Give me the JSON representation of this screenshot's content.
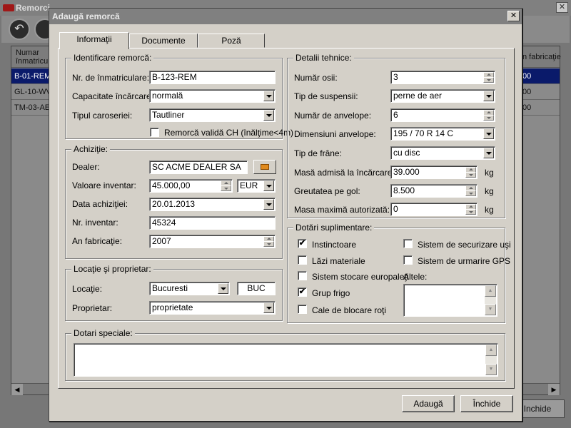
{
  "background": {
    "title": "Remorci",
    "grid_headers": [
      "Numar\nînmatricul",
      "n fabricaţie"
    ],
    "rows": [
      {
        "c1": "B-01-REM",
        "c2": "00",
        "selected": true
      },
      {
        "c1": "GL-10-WV",
        "c2": "00",
        "selected": false
      },
      {
        "c1": "TM-03-AE",
        "c2": "00",
        "selected": false
      }
    ],
    "close_label": "Inchide"
  },
  "dialog": {
    "title": "Adaugă remorcă",
    "close_glyph": "✕",
    "tabs": [
      "Informaţii",
      "Documente",
      "Poză"
    ],
    "active_tab": 0,
    "identificare": {
      "title": "Identificare remorcă:",
      "nr_label": "Nr. de înmatriculare:",
      "nr_value": "B-123-REM",
      "capacitate_label": "Capacitate încărcare:",
      "capacitate_value": "normală",
      "caroserie_label": "Tipul caroseriei:",
      "caroserie_value": "Tautliner",
      "ch_label": "Remorcă validă CH (înălţime<4m)",
      "ch_checked": false
    },
    "achizitie": {
      "title": "Achiziţie:",
      "dealer_label": "Dealer:",
      "dealer_value": "SC ACME DEALER SA",
      "valoare_label": "Valoare inventar:",
      "valoare_value": "45.000,00",
      "moneda_value": "EUR",
      "data_label": "Data achiziţiei:",
      "data_value": "20.01.2013",
      "inventar_label": "Nr. inventar:",
      "inventar_value": "45324",
      "an_label": "An fabricaţie:",
      "an_value": "2007"
    },
    "locatie": {
      "title": "Locaţie şi proprietar:",
      "locatie_label": "Locaţie:",
      "locatie_value": "Bucuresti",
      "locatie_code": "BUC",
      "proprietar_label": "Proprietar:",
      "proprietar_value": "proprietate"
    },
    "detalii": {
      "title": "Detalii tehnice:",
      "osii_label": "Număr osii:",
      "osii_value": "3",
      "suspensie_label": "Tip de suspensii:",
      "suspensie_value": "perne de aer",
      "anvelope_label": "Număr de anvelope:",
      "anvelope_value": "6",
      "dim_label": "Dimensiuni anvelope:",
      "dim_value": "195 / 70 R 14 C",
      "frane_label": "Tip de frâne:",
      "frane_value": "cu disc",
      "masa_adm_label": "Masă admisă la încărcare:",
      "masa_adm_value": "39.000",
      "gol_label": "Greutatea pe gol:",
      "gol_value": "8.500",
      "max_label": "Masa maximă autorizată:",
      "max_value": "0",
      "unit": "kg"
    },
    "dotari": {
      "title": "Dotări suplimentare:",
      "items_left": [
        {
          "label": "Instinctoare",
          "checked": true
        },
        {
          "label": "Lăzi materiale",
          "checked": false
        },
        {
          "label": "Sistem stocare europaleţi",
          "checked": false
        },
        {
          "label": "Grup frigo",
          "checked": true
        },
        {
          "label": "Cale de blocare roţi",
          "checked": false
        }
      ],
      "items_right": [
        {
          "label": "Sistem de securizare uşi",
          "checked": false
        },
        {
          "label": "Sistem de urmarire GPS",
          "checked": false
        }
      ],
      "altele_label": "Altele:"
    },
    "speciale": {
      "title": "Dotari speciale:"
    },
    "buttons": {
      "add": "Adaugă",
      "close": "Închide"
    }
  }
}
